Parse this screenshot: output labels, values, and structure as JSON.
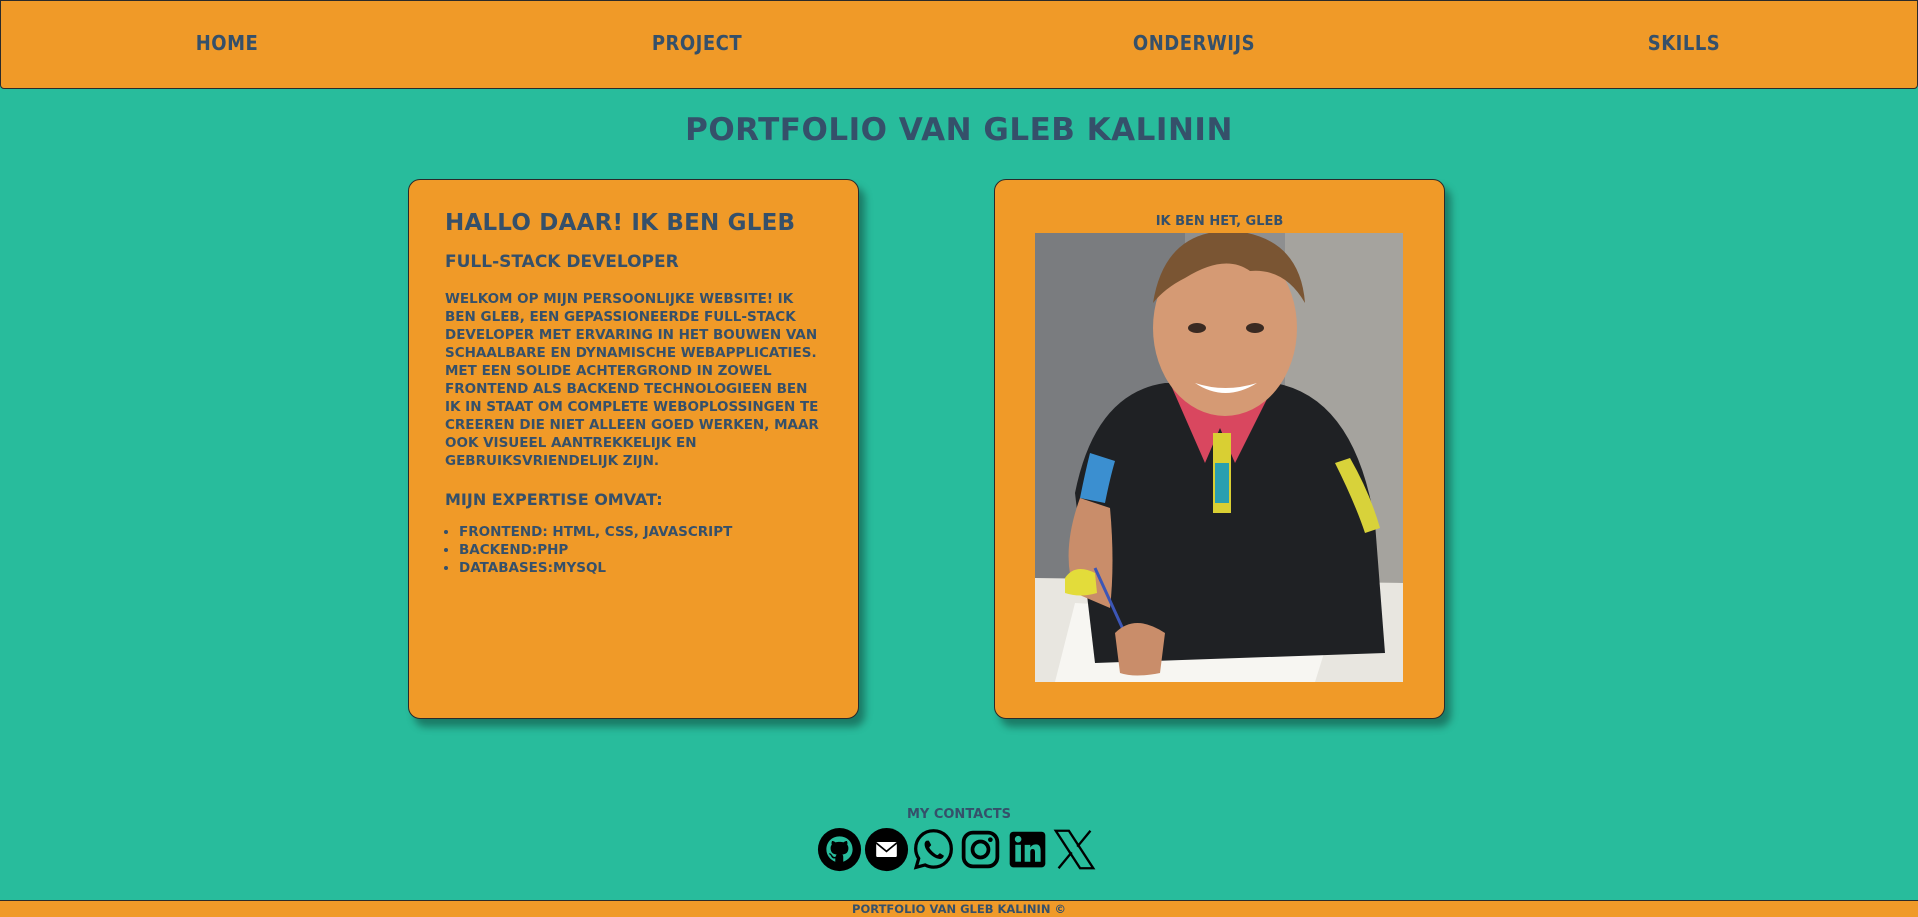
{
  "nav": {
    "home": "HOME",
    "project": "PROJECT",
    "onderwijs": "ONDERWIJS",
    "skills": "SKILLS"
  },
  "page_title": "PORTFOLIO VAN GLEB KALININ",
  "intro": {
    "heading": "HALLO DAAR! IK BEN GLEB",
    "role": "FULL-STACK DEVELOPER",
    "text": "WELKOM OP MIJN PERSOONLIJKE WEBSITE! IK BEN GLEB, EEN GEPASSIONEERDE FULL-STACK DEVELOPER MET ERVARING IN HET BOUWEN VAN SCHAALBARE EN DYNAMISCHE WEBAPPLICATIES. MET EEN SOLIDE ACHTERGROND IN ZOWEL FRONTEND ALS BACKEND TECHNOLOGIEEN BEN IK IN STAAT OM COMPLETE WEBOPLOSSINGEN TE CREEREN DIE NIET ALLEEN GOED WERKEN, MAAR OOK VISUEEL AANTREKKELIJK EN GEBRUIKSVRIENDELIJK ZIJN.",
    "expertise_heading": "MIJN EXPERTISE OMVAT:",
    "expertise": [
      "FRONTEND: HTML, CSS, JAVASCRIPT",
      "BACKEND:PHP",
      "DATABASES:MYSQL"
    ]
  },
  "photo": {
    "caption": "IK BEN HET, GLEB"
  },
  "contacts": {
    "title": "MY CONTACTS",
    "icons": [
      "github-icon",
      "email-icon",
      "whatsapp-icon",
      "instagram-icon",
      "linkedin-icon",
      "x-icon"
    ]
  },
  "footer": {
    "text": "PORTFOLIO VAN GLEB KALININ ©"
  },
  "colors": {
    "background": "#28bc9c",
    "panel": "#f09a28",
    "text": "#35506a"
  }
}
